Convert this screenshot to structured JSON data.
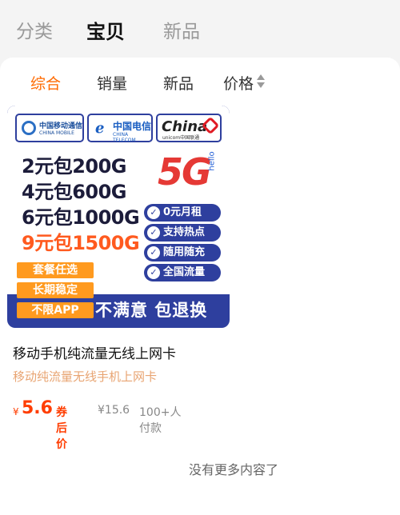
{
  "top_tabs": [
    {
      "label": "分类"
    },
    {
      "label": "宝贝"
    },
    {
      "label": "新品"
    }
  ],
  "sort_bar": {
    "items": [
      "综合",
      "销量",
      "新品",
      "价格"
    ],
    "active_color": "#ff6a00"
  },
  "product": {
    "image": {
      "logos": {
        "mobile_cn": "中国移动通信",
        "mobile_en": "CHINA MOBILE",
        "telecom_cn": "中国电信",
        "telecom_en": "CHINA TELECOM",
        "unicom_en": "China",
        "unicom_sub": "unicom中国联通"
      },
      "plans": [
        "2元包200G",
        "4元包600G",
        "6元包1000G",
        "9元包1500G"
      ],
      "logo_5g": "5G",
      "logo_hello": "hello",
      "features": [
        "0元月租",
        "支持热点",
        "随用随充",
        "全国流量"
      ],
      "tags": [
        "套餐任选",
        "长期稳定",
        "不限APP"
      ],
      "guarantee": "不满意 包退换"
    },
    "title": "移动手机纯流量无线上网卡",
    "subtitle": "移动纯流量无线手机上网卡",
    "currency": "¥",
    "price": "5.6",
    "coupon_label": "券后价",
    "original_price": "¥15.6",
    "buyers": "100+人付款"
  },
  "footer": {
    "no_more": "没有更多内容了"
  },
  "colors": {
    "accent": "#ff6a00",
    "price": "#ff3d00",
    "card_blue": "#2e3f9e",
    "tag_orange": "#ff9a1f"
  }
}
